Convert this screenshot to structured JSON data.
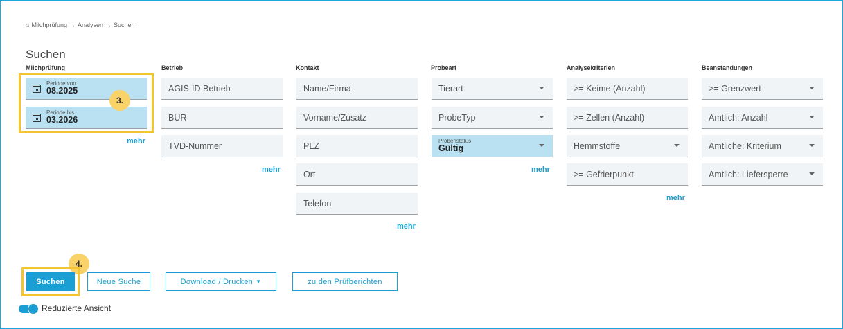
{
  "breadcrumb": {
    "items": [
      "Milchprüfung",
      "Analysen",
      "Suchen"
    ],
    "separator": "→"
  },
  "title": "Suchen",
  "columns": {
    "milchpruefung": {
      "header": "Milchprüfung",
      "fields": [
        {
          "label": "Periode von",
          "value": "08.2025"
        },
        {
          "label": "Periode bis",
          "value": "03.2026"
        }
      ],
      "more": "mehr"
    },
    "betrieb": {
      "header": "Betrieb",
      "fields": [
        "AGIS-ID Betrieb",
        "BUR",
        "TVD-Nummer"
      ],
      "more": "mehr"
    },
    "kontakt": {
      "header": "Kontakt",
      "fields": [
        "Name/Firma",
        "Vorname/Zusatz",
        "PLZ",
        "Ort",
        "Telefon"
      ],
      "more": "mehr"
    },
    "probeart": {
      "header": "Probeart",
      "fields": [
        "Tierart",
        "ProbeTyp"
      ],
      "status": {
        "label": "Probenstatus",
        "value": "Gültig"
      },
      "more": "mehr"
    },
    "analysekriterien": {
      "header": "Analysekriterien",
      "fields": [
        ">= Keime (Anzahl)",
        ">= Zellen (Anzahl)",
        "Hemmstoffe",
        ">= Gefrierpunkt"
      ],
      "more": "mehr"
    },
    "beanstandungen": {
      "header": "Beanstandungen",
      "fields": [
        ">= Grenzwert",
        "Amtlich: Anzahl",
        "Amtliche: Kriterium",
        "Amtlich: Liefersperre"
      ]
    }
  },
  "annotations": {
    "step3": "3.",
    "step4": "4."
  },
  "buttons": {
    "search": "Suchen",
    "new_search": "Neue Suche",
    "download": "Download / Drucken",
    "reports": "zu den Prüfberichten"
  },
  "toggle": {
    "label": "Reduzierte Ansicht",
    "on": true
  },
  "colors": {
    "accent": "#1a9ed3",
    "highlight": "#f5c431",
    "active_field": "#b9e1f2"
  }
}
